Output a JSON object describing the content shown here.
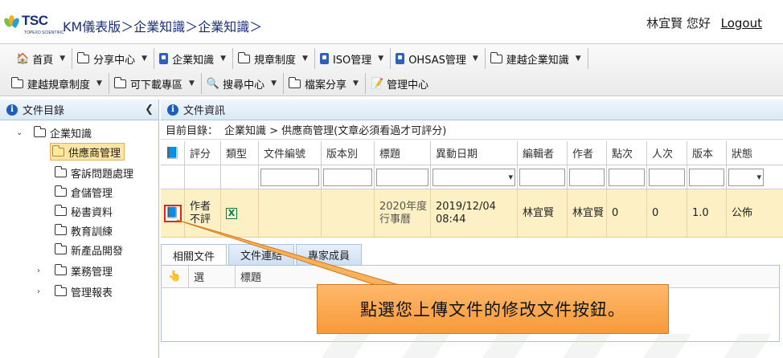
{
  "header": {
    "logo_text": "TSC",
    "logo_sub": "TOPEXO SCIENTIFIC",
    "breadcrumb": "KM儀表版＞企業知識＞企業知識＞",
    "user_greeting": "林宜賢 您好",
    "logout_label": "Logout"
  },
  "menu": {
    "row1": [
      {
        "label": "首頁",
        "icon": "home-icon"
      },
      {
        "label": "分享中心",
        "icon": "folder-icon"
      },
      {
        "label": "企業知識",
        "icon": "book-icon"
      },
      {
        "label": "規章制度",
        "icon": "folder-icon"
      },
      {
        "label": "ISO管理",
        "icon": "book-icon"
      },
      {
        "label": "OHSAS管理",
        "icon": "book-icon"
      },
      {
        "label": "建越企業知識",
        "icon": "folder-icon"
      }
    ],
    "row2": [
      {
        "label": "建越規章制度",
        "icon": "folder-icon"
      },
      {
        "label": "可下載專區",
        "icon": "folder-icon"
      },
      {
        "label": "搜尋中心",
        "icon": "search-icon"
      },
      {
        "label": "檔案分享",
        "icon": "folder-icon"
      },
      {
        "label": "管理中心",
        "icon": "admin-icon"
      }
    ]
  },
  "left_panel": {
    "title": "文件目錄",
    "root": "企業知識",
    "items": [
      "供應商管理",
      "客訴問題處理",
      "倉儲管理",
      "秘書資料",
      "教育訓練",
      "新產品開發",
      "業務管理",
      "管理報表"
    ]
  },
  "right_panel": {
    "title": "文件資訊",
    "current_dir_label": "目前目錄：",
    "current_dir": "企業知識 > 供應商管理(文章必須看過才可評分)",
    "columns": [
      "評分",
      "類型",
      "文件編號",
      "版本別",
      "標題",
      "異動日期",
      "編輯者",
      "作者",
      "點次",
      "人次",
      "版本",
      "狀態"
    ],
    "row": {
      "rating": "作者不評",
      "type": "X",
      "doc_no": "",
      "version_type": "",
      "title": "2020年度行事曆",
      "date": "2019/12/04 08:44",
      "editor": "林宜賢",
      "author": "林宜賢",
      "clicks": "0",
      "people": "0",
      "version": "1.0",
      "status": "公佈"
    }
  },
  "tabs": [
    "相關文件",
    "文件連結",
    "專家成員"
  ],
  "subgrid_columns": [
    "選",
    "標題"
  ],
  "callout_text": "點選您上傳文件的修改文件按鈕。",
  "colors": {
    "accent_blue": "#1f5fb8",
    "row_highlight": "#fdf0c4",
    "callout": "#f79a3a",
    "red_outline": "#e0261c"
  }
}
